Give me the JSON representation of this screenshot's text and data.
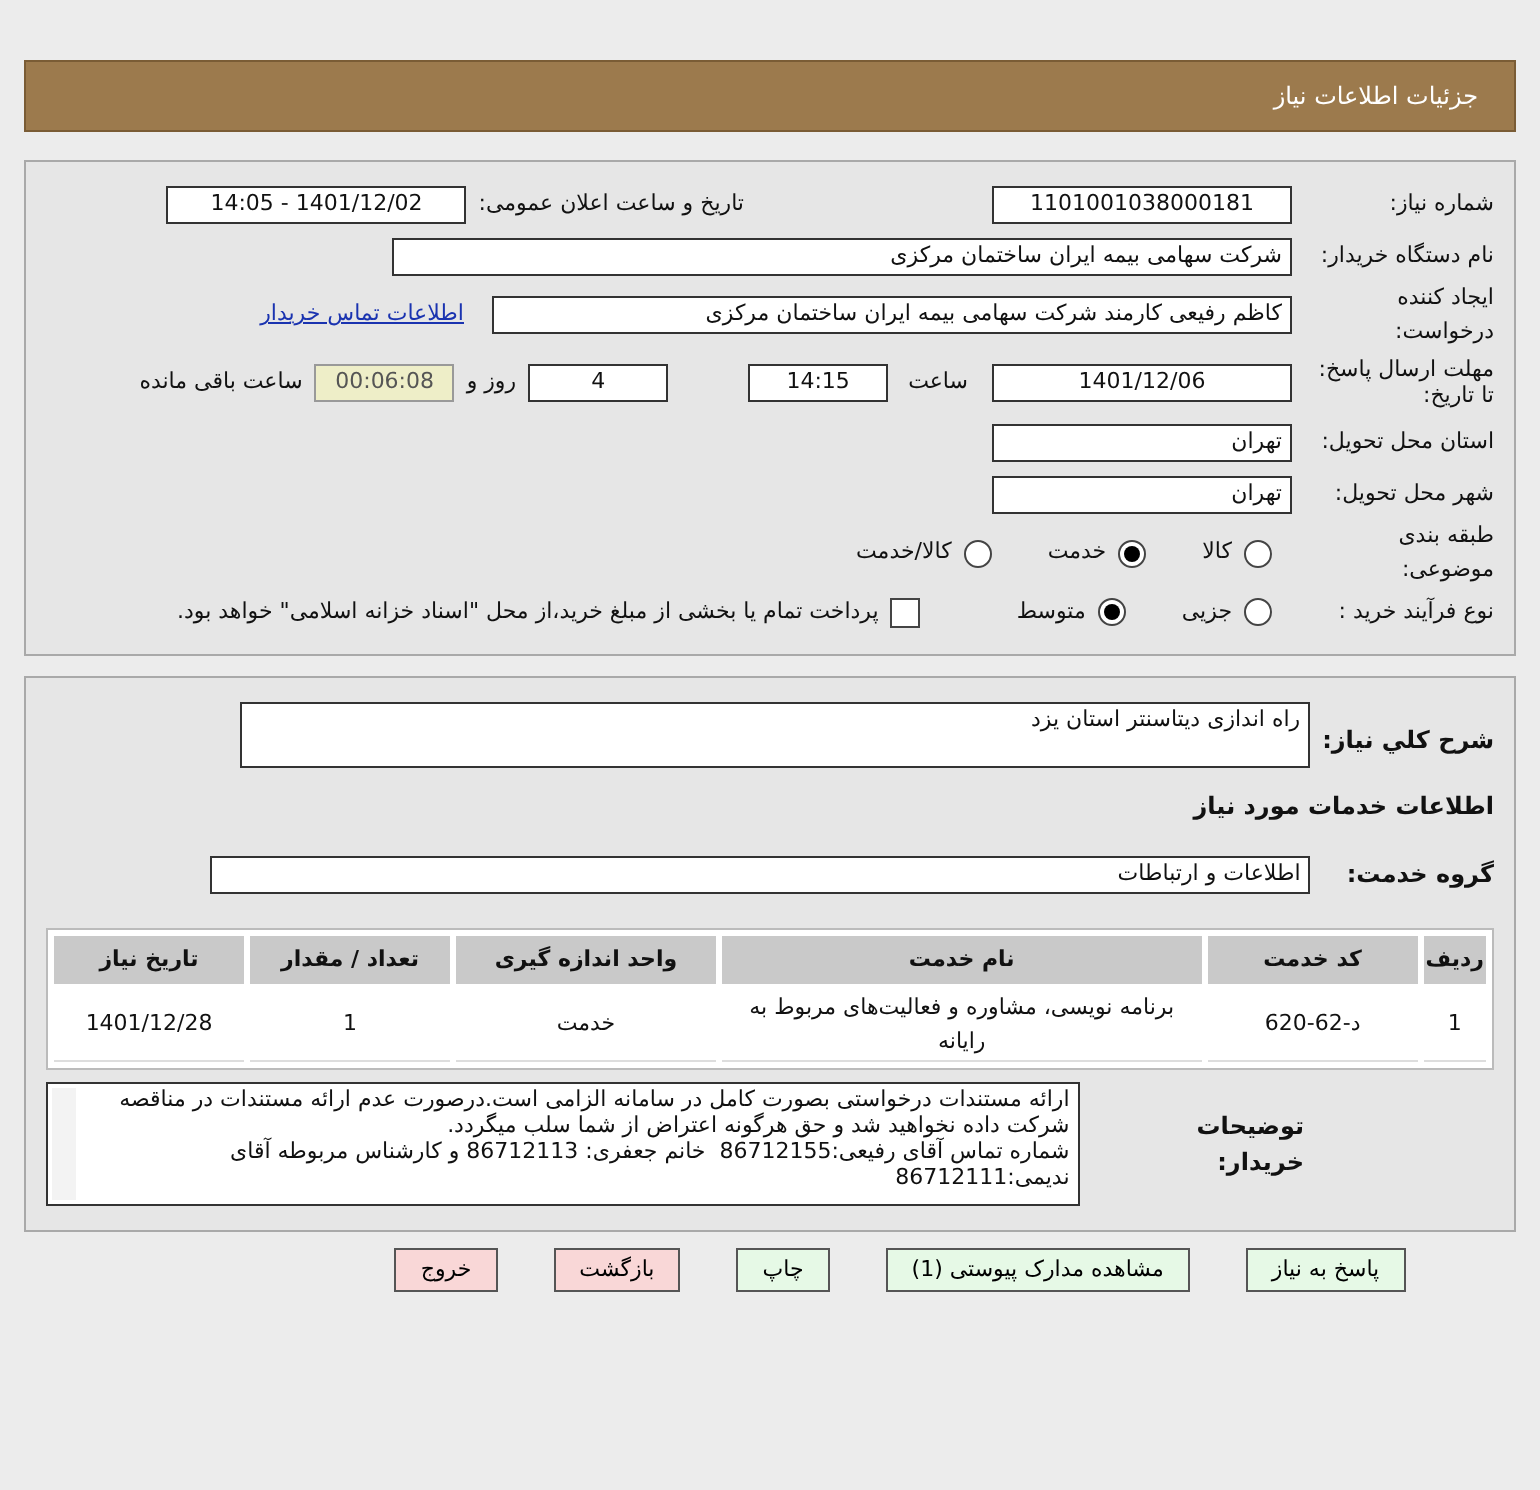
{
  "header": {
    "title": "جزئیات اطلاعات نیاز"
  },
  "need_number": {
    "label": "شماره نیاز:",
    "value": "1101001038000181"
  },
  "announce": {
    "label": "تاریخ و ساعت اعلان عمومی:",
    "value": "1401/12/02 - 14:05"
  },
  "buyer_org": {
    "label": "نام دستگاه خریدار:",
    "value": "شرکت سهامی بیمه ایران ساختمان مرکزی"
  },
  "requester": {
    "label": "ایجاد کننده درخواست:",
    "value": "کاظم رفیعی کارمند شرکت سهامی بیمه ایران ساختمان مرکزی",
    "link": "اطلاعات تماس خریدار"
  },
  "deadline": {
    "label": "مهلت ارسال پاسخ: تا تاریخ:",
    "date": "1401/12/06",
    "time_label": "ساعت",
    "time": "14:15",
    "days": "4",
    "days_label": "روز و",
    "remaining": "00:06:08",
    "remaining_label": "ساعت باقی مانده"
  },
  "province": {
    "label": "استان محل تحویل:",
    "value": "تهران"
  },
  "city": {
    "label": "شهر محل تحویل:",
    "value": "تهران"
  },
  "category": {
    "label": "طبقه بندی موضوعی:",
    "options": [
      {
        "label": "کالا",
        "selected": false
      },
      {
        "label": "خدمت",
        "selected": true
      },
      {
        "label": "کالا/خدمت",
        "selected": false
      }
    ]
  },
  "purchase_type": {
    "label": "نوع فرآیند خرید :",
    "options": [
      {
        "label": "جزیی",
        "selected": false
      },
      {
        "label": "متوسط",
        "selected": true
      }
    ],
    "treasury": {
      "checked": false,
      "label": "پرداخت تمام یا بخشی از مبلغ خرید،از محل \"اسناد خزانه اسلامی\" خواهد بود."
    }
  },
  "description": {
    "label": "شرح کلي نياز:",
    "value": "راه اندازی دیتاسنتر استان یزد"
  },
  "services_title": "اطلاعات خدمات مورد نیاز",
  "service_group": {
    "label": "گروه خدمت:",
    "value": "اطلاعات و ارتباطات"
  },
  "table": {
    "columns": [
      "ردیف",
      "کد خدمت",
      "نام خدمت",
      "واحد اندازه گیری",
      "تعداد / مقدار",
      "تاریخ نیاز"
    ],
    "rows": [
      [
        "1",
        "د-62-620",
        "برنامه نویسی، مشاوره و فعالیت‌های مربوط به رایانه",
        "خدمت",
        "1",
        "1401/12/28"
      ]
    ]
  },
  "buyer_notes": {
    "label": "توضیحات خریدار:",
    "paragraphs": [
      "ارائه مستندات درخواستی بصورت کامل در سامانه الزامی است.درصورت عدم ارائه مستندات در مناقصه شرکت داده نخواهید شد و حق هرگونه اعتراض از شما سلب میگردد.",
      "شماره تماس آقای رفیعی:86712155  خانم جعفری: 86712113 و کارشناس مربوطه آقای ندیمی:86712111"
    ]
  },
  "buttons": [
    {
      "label": "پاسخ به نیاز",
      "kind": "green"
    },
    {
      "label": "مشاهده مدارک پیوستی (1)",
      "kind": "green"
    },
    {
      "label": "چاپ",
      "kind": "green"
    },
    {
      "label": "بازگشت",
      "kind": "red"
    },
    {
      "label": "خروج",
      "kind": "red"
    }
  ]
}
